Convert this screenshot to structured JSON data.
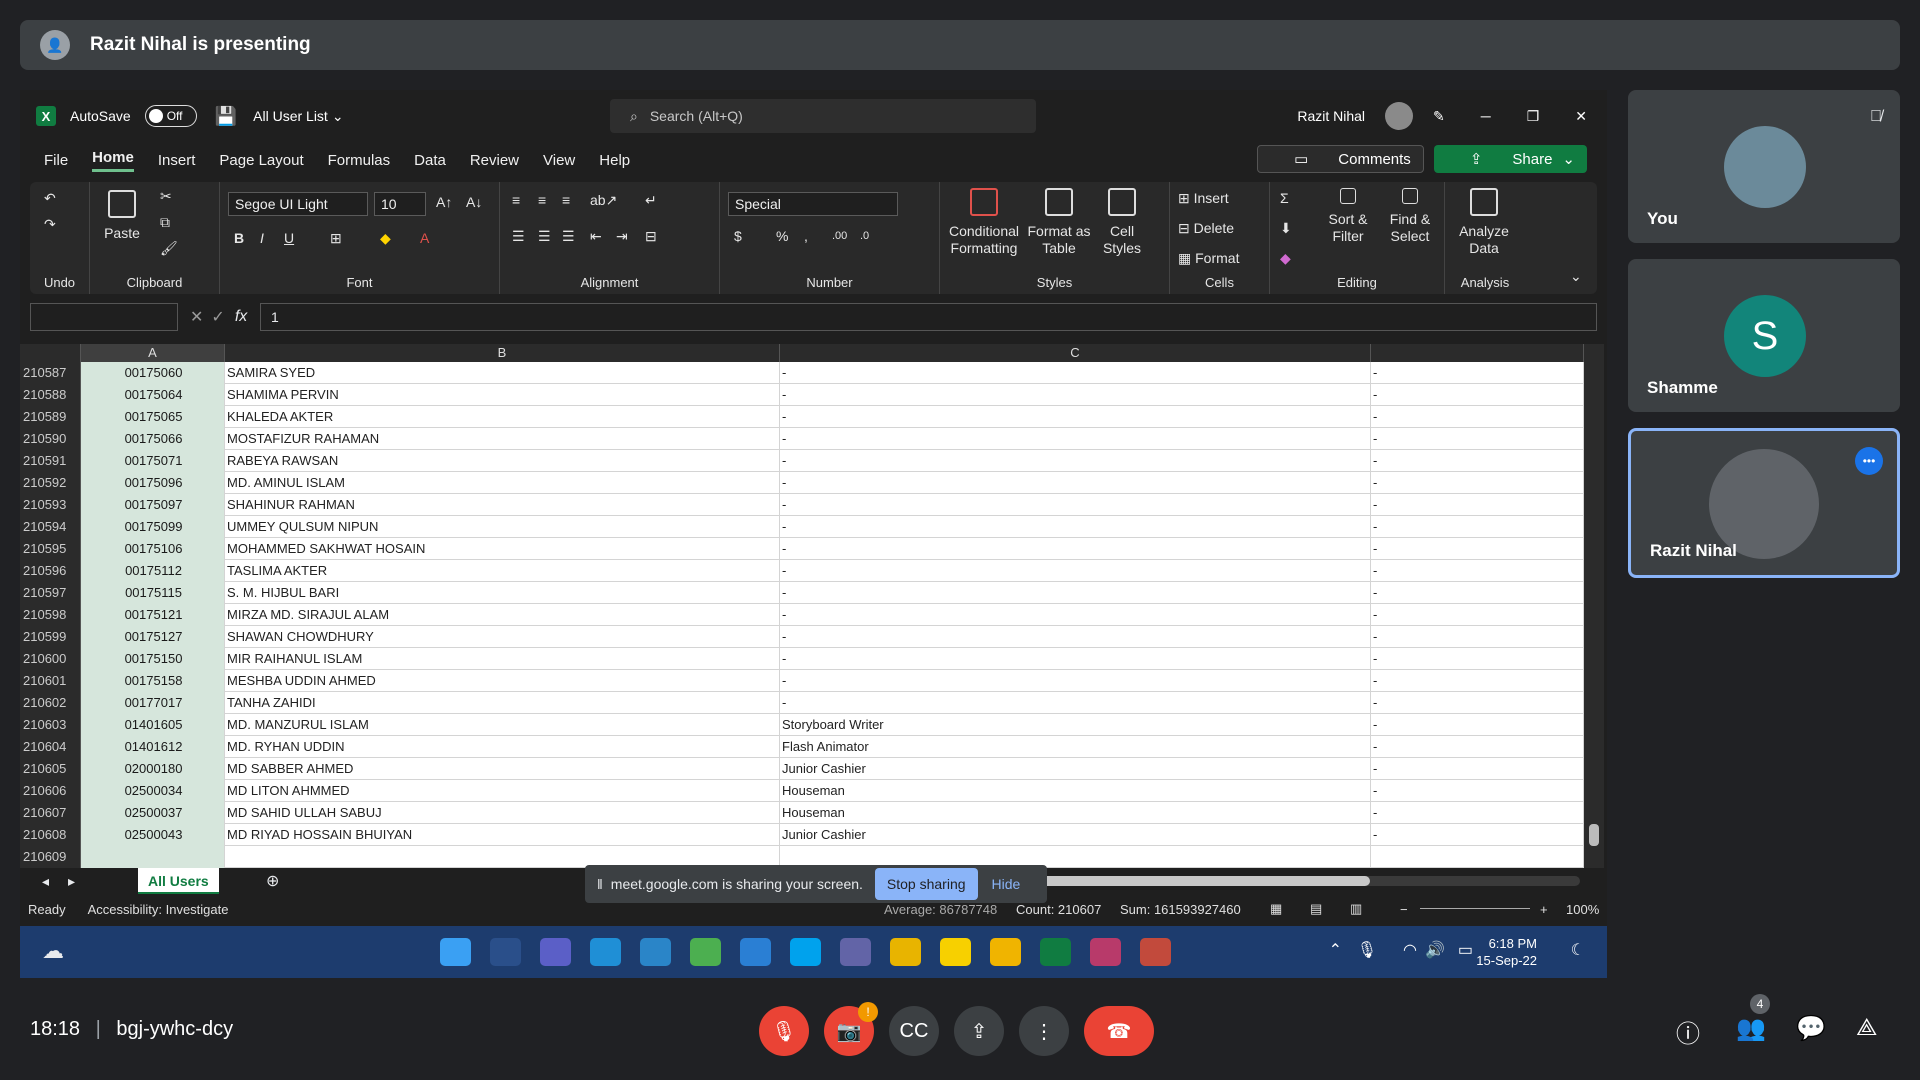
{
  "presenting": {
    "text": "Razit Nihal is presenting"
  },
  "excel": {
    "autosave_label": "AutoSave",
    "autosave_state": "Off",
    "file_name": "All User List",
    "search_placeholder": "Search (Alt+Q)",
    "user_name": "Razit Nihal",
    "menu": [
      "File",
      "Home",
      "Insert",
      "Page Layout",
      "Formulas",
      "Data",
      "Review",
      "View",
      "Help"
    ],
    "comments_label": "Comments",
    "share_label": "Share",
    "ribbon": {
      "undo": "Undo",
      "paste": "Paste",
      "clipboard": "Clipboard",
      "font_name": "Segoe UI Light",
      "font_size": "10",
      "font": "Font",
      "alignment": "Alignment",
      "number_format": "Special",
      "number": "Number",
      "conditional_formatting": "Conditional Formatting",
      "format_as_table": "Format as Table",
      "cell_styles": "Cell Styles",
      "styles": "Styles",
      "insert": "Insert",
      "delete": "Delete",
      "format": "Format",
      "cells": "Cells",
      "sort_filter": "Sort & Filter",
      "find_select": "Find & Select",
      "editing": "Editing",
      "analyze_data": "Analyze Data",
      "analysis": "Analysis"
    },
    "formula_value": "1",
    "columns": [
      "A",
      "B",
      "C"
    ],
    "rows": [
      [
        "210587",
        "00175060",
        "SAMIRA SYED",
        "-",
        "-"
      ],
      [
        "210588",
        "00175064",
        "SHAMIMA PERVIN",
        "-",
        "-"
      ],
      [
        "210589",
        "00175065",
        "KHALEDA  AKTER",
        "-",
        "-"
      ],
      [
        "210590",
        "00175066",
        "MOSTAFIZUR RAHAMAN",
        "-",
        "-"
      ],
      [
        "210591",
        "00175071",
        "RABEYA RAWSAN",
        "-",
        "-"
      ],
      [
        "210592",
        "00175096",
        "MD. AMINUL ISLAM",
        "-",
        "-"
      ],
      [
        "210593",
        "00175097",
        "SHAHINUR RAHMAN",
        "-",
        "-"
      ],
      [
        "210594",
        "00175099",
        "UMMEY QULSUM NIPUN",
        "-",
        "-"
      ],
      [
        "210595",
        "00175106",
        "MOHAMMED SAKHWAT HOSAIN",
        "-",
        "-"
      ],
      [
        "210596",
        "00175112",
        "TASLIMA AKTER",
        "-",
        "-"
      ],
      [
        "210597",
        "00175115",
        "S. M. HIJBUL BARI",
        "-",
        "-"
      ],
      [
        "210598",
        "00175121",
        "MIRZA MD. SIRAJUL ALAM",
        "-",
        "-"
      ],
      [
        "210599",
        "00175127",
        "SHAWAN CHOWDHURY",
        "-",
        "-"
      ],
      [
        "210600",
        "00175150",
        "MIR RAIHANUL ISLAM",
        "-",
        "-"
      ],
      [
        "210601",
        "00175158",
        "MESHBA UDDIN AHMED",
        "-",
        "-"
      ],
      [
        "210602",
        "00177017",
        "TANHA ZAHIDI",
        "-",
        "-"
      ],
      [
        "210603",
        "01401605",
        "MD. MANZURUL ISLAM",
        "Storyboard Writer",
        "-"
      ],
      [
        "210604",
        "01401612",
        "MD. RYHAN UDDIN",
        "Flash Animator",
        "-"
      ],
      [
        "210605",
        "02000180",
        "MD SABBER AHMED",
        "Junior Cashier",
        "-"
      ],
      [
        "210606",
        "02500034",
        "MD LITON AHMMED",
        "Houseman",
        "-"
      ],
      [
        "210607",
        "02500037",
        "MD SAHID ULLAH SABUJ",
        "Houseman",
        "-"
      ],
      [
        "210608",
        "02500043",
        "MD RIYAD HOSSAIN BHUIYAN",
        "Junior Cashier",
        "-"
      ],
      [
        "210609",
        "",
        "",
        "",
        ""
      ]
    ],
    "sheet_tab": "All Users",
    "status_ready": "Ready",
    "accessibility": "Accessibility: Investigate",
    "status_average": "Average: 86787748",
    "status_count": "Count: 210607",
    "status_sum": "Sum: 161593927460",
    "zoom": "100%",
    "share_notice": "meet.google.com is sharing your screen.",
    "stop_sharing": "Stop sharing",
    "hide": "Hide",
    "clock_time": "6:18 PM",
    "clock_date": "15-Sep-22"
  },
  "participants": [
    {
      "name": "You"
    },
    {
      "name": "Shamme",
      "initial": "S",
      "color": "#12857a"
    },
    {
      "name": "Razit Nihal"
    }
  ],
  "meeting": {
    "time": "18:18",
    "code": "bgj-ywhc-dcy",
    "participants_count": "4"
  }
}
